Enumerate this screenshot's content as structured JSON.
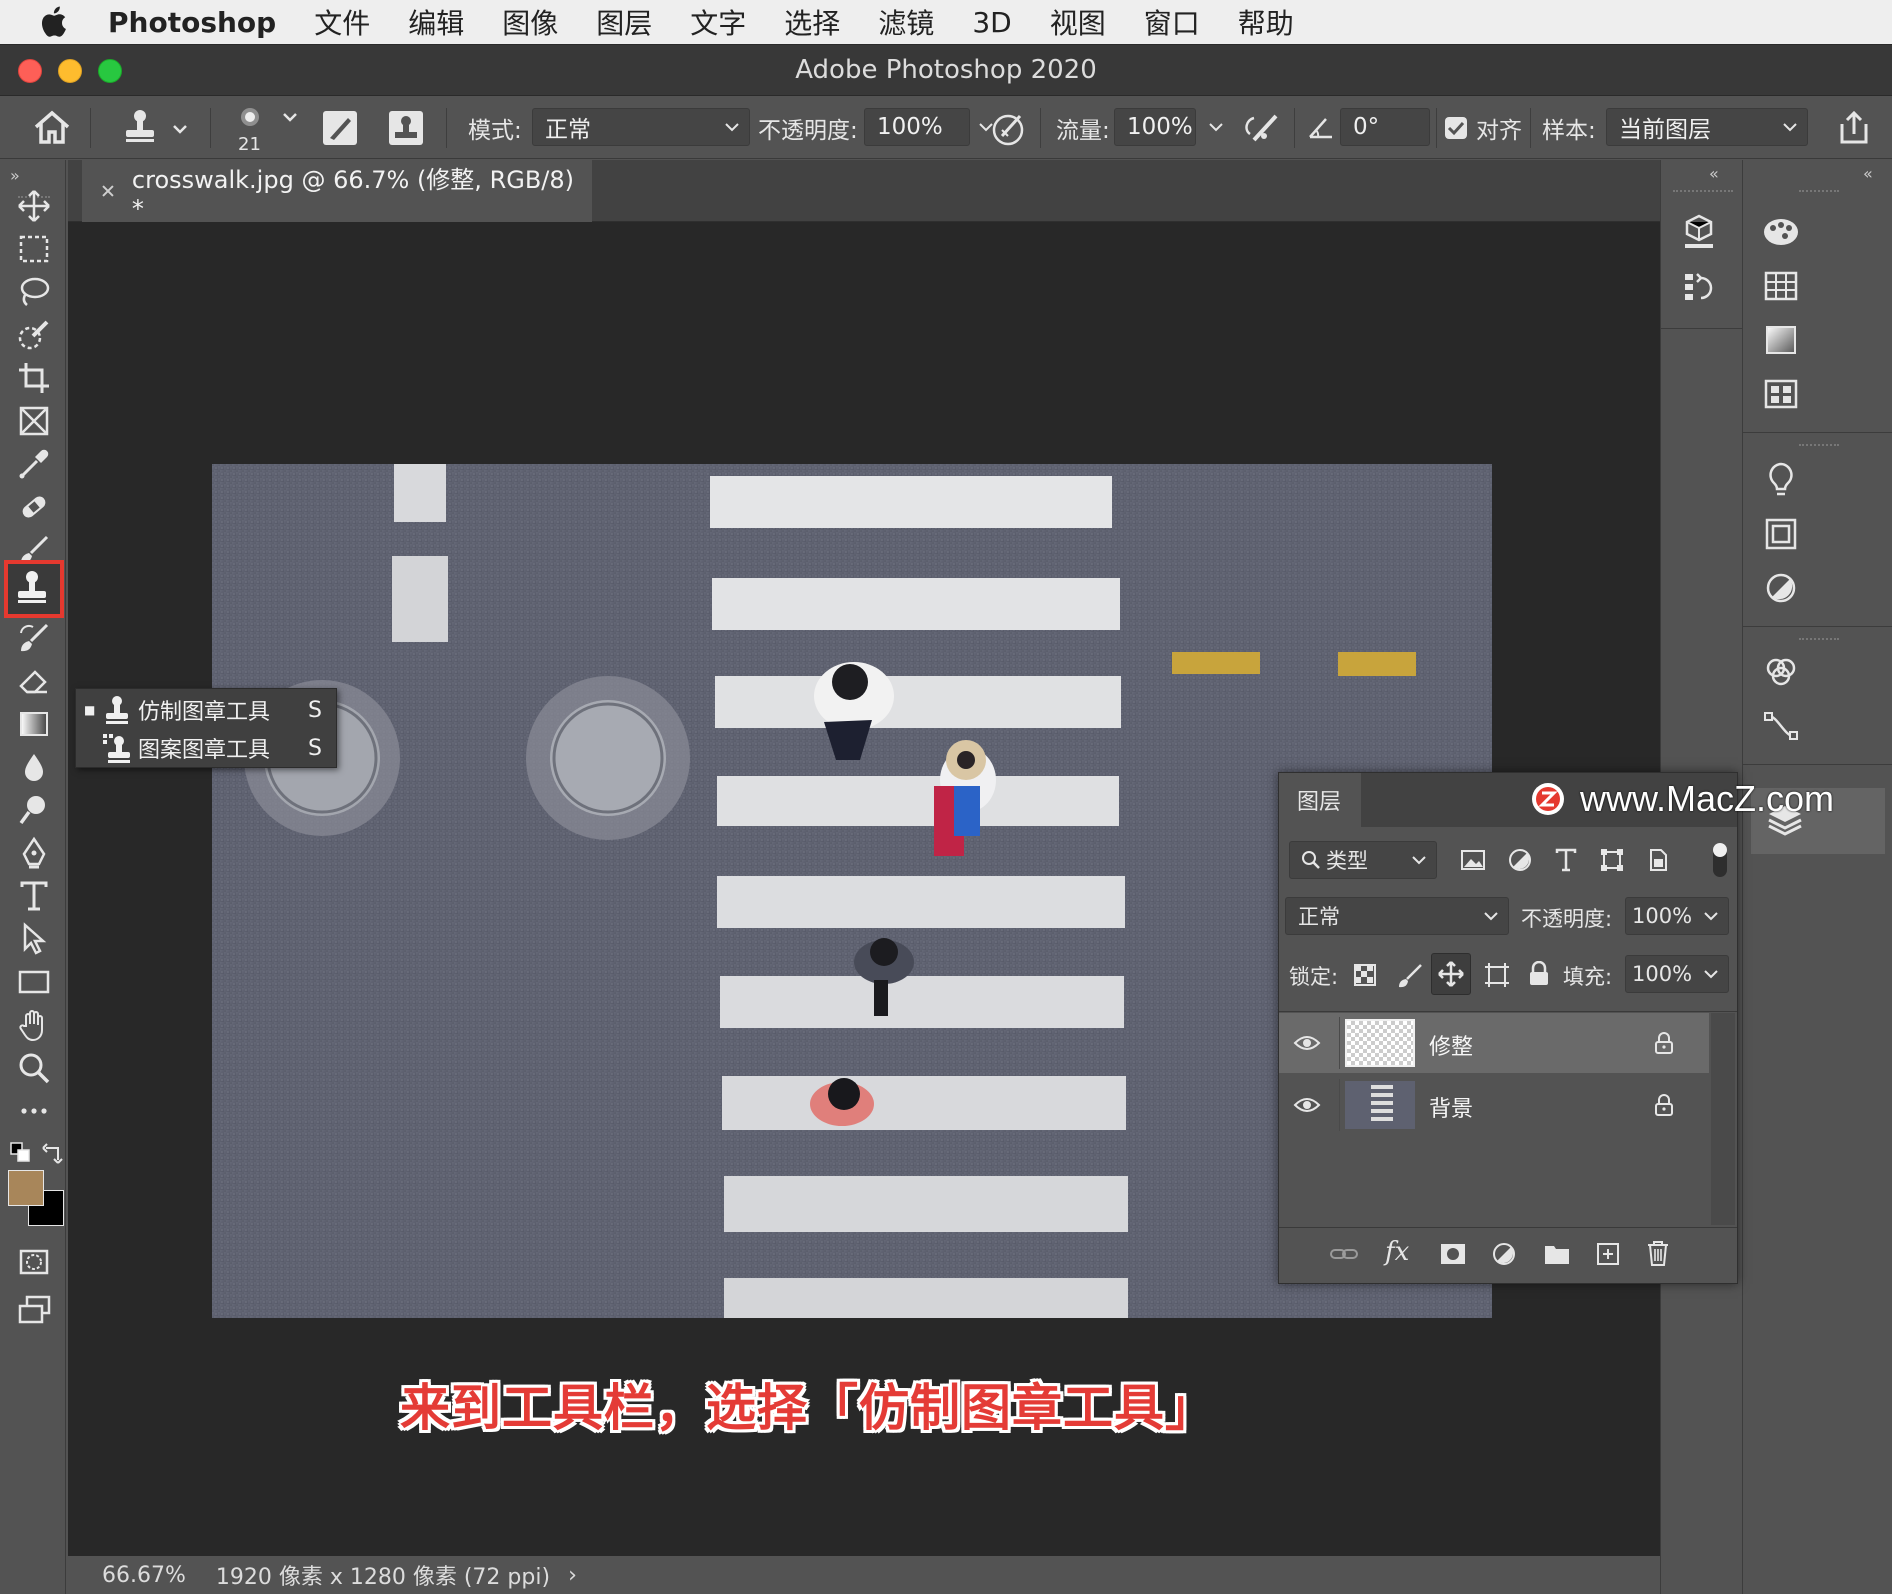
{
  "menubar": {
    "app_name": "Photoshop",
    "items": [
      "文件",
      "编辑",
      "图像",
      "图层",
      "文字",
      "选择",
      "滤镜",
      "3D",
      "视图",
      "窗口",
      "帮助"
    ]
  },
  "window": {
    "title": "Adobe Photoshop 2020"
  },
  "options": {
    "brush_size": "21",
    "mode_label": "模式:",
    "mode_value": "正常",
    "opacity_label": "不透明度:",
    "opacity_value": "100%",
    "flow_label": "流量:",
    "flow_value": "100%",
    "angle_value": "0°",
    "aligned_label": "对齐",
    "aligned_checked": true,
    "sample_label": "样本:",
    "sample_value": "当前图层"
  },
  "document": {
    "tab_title": "crosswalk.jpg @ 66.7% (修整, RGB/8) *",
    "zoom": "66.67%",
    "doc_info": "1920 像素 x 1280 像素 (72 ppi)"
  },
  "flyout": {
    "items": [
      {
        "label": "仿制图章工具",
        "shortcut": "S",
        "selected": true
      },
      {
        "label": "图案图章工具",
        "shortcut": "S",
        "selected": false
      }
    ]
  },
  "layers_panel": {
    "tab": "图层",
    "filter_kind": "类型",
    "blend_mode": "正常",
    "opacity_label": "不透明度:",
    "opacity_value": "100%",
    "lock_label": "锁定:",
    "fill_label": "填充:",
    "fill_value": "100%",
    "layers": [
      {
        "name": "修整",
        "visible": true,
        "selected": true
      },
      {
        "name": "背景",
        "visible": true,
        "selected": false
      }
    ]
  },
  "watermark": "www.MacZ.com",
  "caption": "来到工具栏，选择「仿制图章工具」",
  "colors": {
    "foreground": "#a8865a",
    "background": "#000000",
    "highlight": "#e5392f"
  }
}
